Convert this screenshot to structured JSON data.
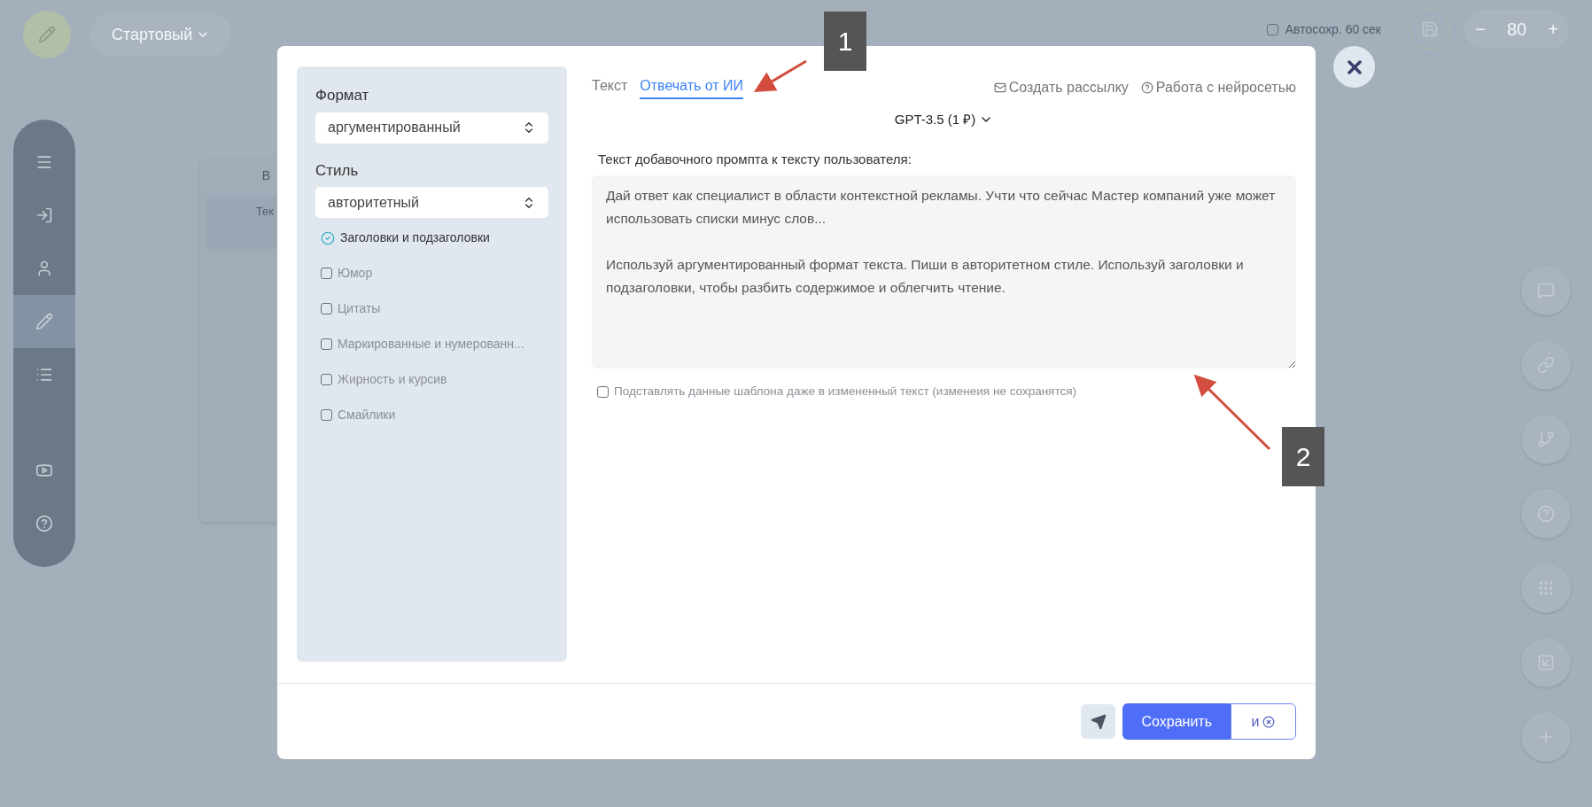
{
  "topbar": {
    "preset": "Стартовый",
    "autosave": {
      "label": "Автосохр. 60 сек",
      "checked": false
    },
    "zoom": {
      "minus": "−",
      "value": "80",
      "plus": "+"
    }
  },
  "left_toolbar": [
    {
      "selected": false
    },
    {
      "selected": false
    },
    {
      "selected": false
    },
    {
      "selected": true
    },
    {
      "selected": false
    },
    {
      "selected": false
    },
    {
      "selected": false
    }
  ],
  "canvas_node": {
    "title": "В",
    "row": "Тек"
  },
  "modal": {
    "format": {
      "label": "Формат",
      "value": "аргументированный"
    },
    "style": {
      "label": "Стиль",
      "value": "авторитетный"
    },
    "options": [
      {
        "label": "Заголовки и подзаголовки",
        "checked": true
      },
      {
        "label": "Юмор",
        "checked": false
      },
      {
        "label": "Цитаты",
        "checked": false
      },
      {
        "label": "Маркированные и нумерованн...",
        "checked": false
      },
      {
        "label": "Жирность и курсив",
        "checked": false
      },
      {
        "label": "Смайлики",
        "checked": false
      }
    ],
    "tabs": [
      {
        "label": "Текст",
        "selected": false
      },
      {
        "label": "Отвечать от ИИ",
        "selected": true
      }
    ],
    "actions": [
      {
        "label": "Создать рассылку"
      },
      {
        "label": "Работа с нейросетью"
      }
    ],
    "model": "GPT-3.5 (1 ₽)",
    "prompt": {
      "label": "Текст добавочного промпта к тексту пользователя:",
      "value": "Дай ответ как специалист в области контекстной рекламы. Учти что сейчас Мастер компаний уже может использовать списки минус слов...\n\nИспользуй аргументированный формат текста. Пиши в авторитетном стиле. Используй заголовки и подзаголовки, чтобы разбить содержимое и облегчить чтение."
    },
    "substitute": {
      "label": "Подставлять данные шаблона даже в измененный текст (изменеия не сохранятся)",
      "checked": false
    },
    "save_button": "Сохранить",
    "save_close_button": "и"
  },
  "callouts": [
    "1",
    "2"
  ]
}
